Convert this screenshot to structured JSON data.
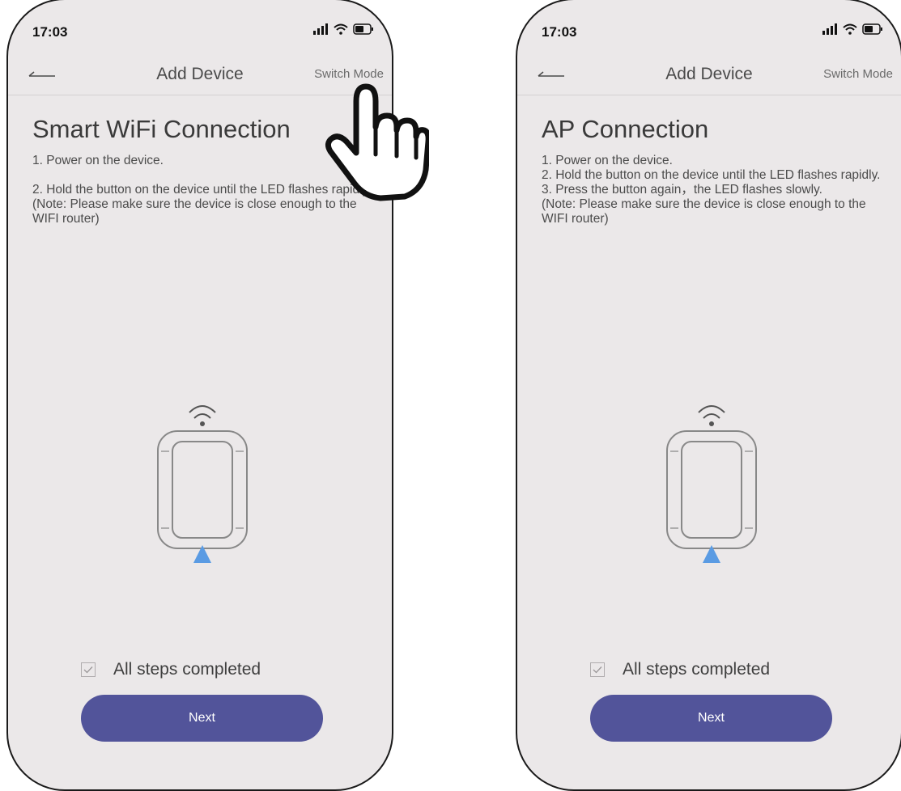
{
  "colors": {
    "screen_bg": "#ebe8e9",
    "accent_button": "#52549a",
    "led_indicator": "#5a9be3"
  },
  "screens": [
    {
      "status_time": "17:03",
      "nav": {
        "title": "Add Device",
        "switch_mode": "Switch Mode",
        "back_icon": "back-arrow-icon"
      },
      "heading": "Smart WiFi Connection",
      "steps": [
        "1. Power on the device.",
        "",
        "2. Hold the button on the device until the LED flashes rapidly.",
        "(Note: Please make sure the device is close enough to the WIFI router)"
      ],
      "confirm_label": "All steps completed",
      "next_label": "Next"
    },
    {
      "status_time": "17:03",
      "nav": {
        "title": "Add Device",
        "switch_mode": "Switch Mode",
        "back_icon": "back-arrow-icon"
      },
      "heading": "AP Connection",
      "steps": [
        "1. Power on the device.",
        "2. Hold the button on the device until the LED flashes rapidly.",
        "3. Press the button again，the LED flashes slowly.",
        "(Note: Please make sure the device is close enough to the WIFI router)"
      ],
      "confirm_label": "All steps completed",
      "next_label": "Next"
    }
  ],
  "icons": [
    "signal-icon",
    "wifi-icon",
    "battery-icon",
    "pointing-hand-icon",
    "device-wifi-icon",
    "checkmark-icon"
  ]
}
